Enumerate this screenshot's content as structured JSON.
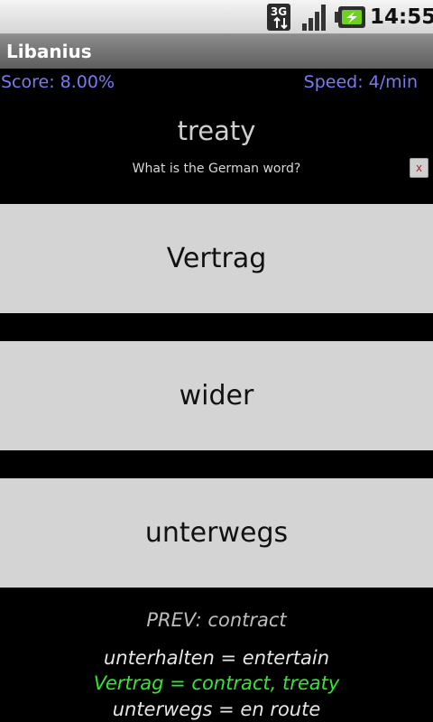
{
  "status_bar": {
    "network_label": "3G",
    "time": "14:55",
    "icons": [
      "network-3g-icon",
      "signal-strength-icon",
      "battery-charging-icon"
    ]
  },
  "app": {
    "title": "Libanius"
  },
  "stats": {
    "score": "Score: 8.00%",
    "speed": "Speed: 4/min"
  },
  "question": {
    "word": "treaty",
    "prompt": "What is the German word?",
    "close_label": "x"
  },
  "answers": [
    {
      "label": "Vertrag"
    },
    {
      "label": "wider"
    },
    {
      "label": "unterwegs"
    }
  ],
  "previous": {
    "text": "PREV: contract"
  },
  "history": [
    {
      "text": "unterhalten = entertain",
      "color": "#e6e6e6"
    },
    {
      "text": "Vertrag = contract, treaty",
      "color": "#33e633"
    },
    {
      "text": "unterwegs = en route",
      "color": "#e6e6e6"
    }
  ],
  "colors": {
    "accent_blue": "#7a7af0",
    "correct_green": "#33e633",
    "answer_bg": "#d4d4d4",
    "close_x": "#c02020"
  }
}
